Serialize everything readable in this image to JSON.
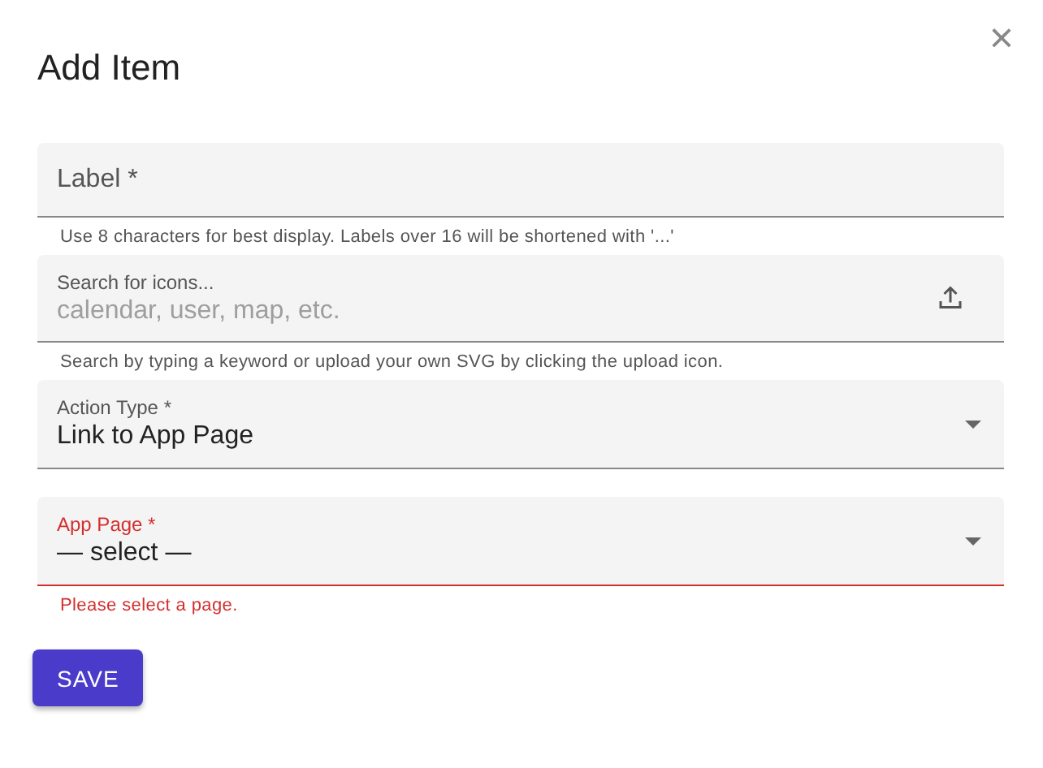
{
  "dialog": {
    "title": "Add Item",
    "close": "×"
  },
  "fields": [
    {
      "kind": "text",
      "label": "Label *",
      "helper": "Use 8 characters for best display. Labels over 16 will be shortened with '...'",
      "error": false
    },
    {
      "kind": "search",
      "label": "Search for icons...",
      "placeholder": "calendar, user, map, etc.",
      "helper": "Search by typing a keyword or upload your own SVG by clicking the upload icon.",
      "error": false
    },
    {
      "kind": "select",
      "label": "Action Type *",
      "value": "Link to App Page",
      "error": false
    },
    {
      "kind": "select",
      "label": "App Page *",
      "value": "— select —",
      "helper": "Please select a page.",
      "error": true
    }
  ],
  "save": "SAVE"
}
